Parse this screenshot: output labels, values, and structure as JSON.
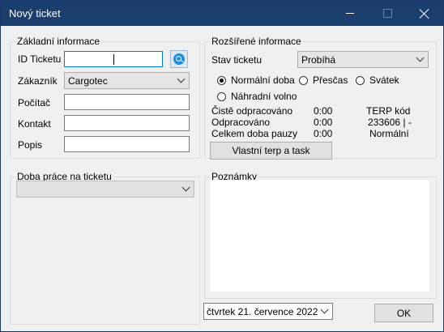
{
  "window": {
    "title": "Nový ticket"
  },
  "basic": {
    "legend": "Základní informace",
    "id_label": "ID Ticketu",
    "id_value": "",
    "customer_label": "Zákazník",
    "customer_value": "Cargotec",
    "computer_label": "Počítač",
    "contact_label": "Kontakt",
    "desc_label": "Popis"
  },
  "extended": {
    "legend": "Rozšířené informace",
    "status_label": "Stav ticketu",
    "status_value": "Probíhá",
    "radios": {
      "normal": "Normální doba",
      "overtime": "Přesčas",
      "holiday": "Svátek",
      "substitute": "Náhradní volno"
    },
    "selected_radio": "normal",
    "clean_label": "Čistě odpracováno",
    "clean_value": "0:00",
    "worked_label": "Odpracováno",
    "worked_value": "0:00",
    "pause_label": "Celkem doba pauzy",
    "pause_value": "0:00",
    "terp_label": "TERP kód",
    "terp_value": "233606 | -",
    "terp_type": "Normální",
    "terp_button": "Vlastní terp a task"
  },
  "work_time": {
    "legend": "Doba práce na ticketu",
    "value": ""
  },
  "notes": {
    "legend": "Poznámky",
    "text": ""
  },
  "date": {
    "value": "čtvrtek  21. července 2022"
  },
  "ok_button": "OK",
  "colors": {
    "titlebar": "#1a3e6e",
    "accent": "#0078d7",
    "search": "#1e8fd6"
  }
}
